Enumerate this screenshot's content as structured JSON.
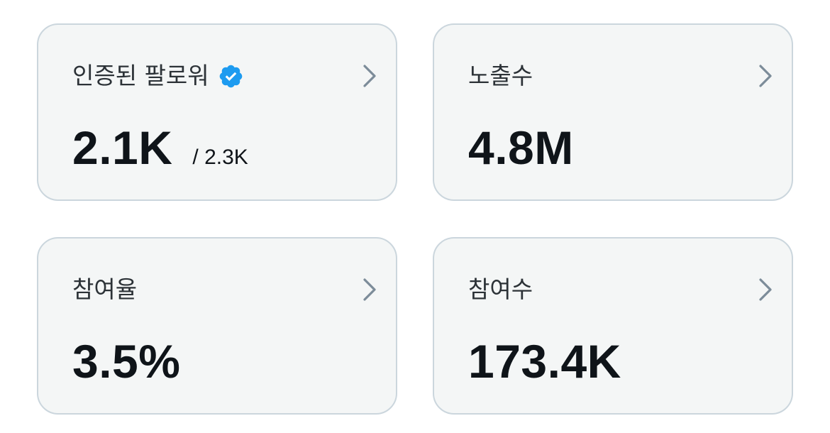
{
  "cards": [
    {
      "label": "인증된 팔로워",
      "value": "2.1K",
      "sub": "/ 2.3K",
      "badge_icon": "verified-badge-icon",
      "badge_color": "#1d9bf0",
      "chevron_icon": "chevron-right-icon"
    },
    {
      "label": "노출수",
      "value": "4.8M",
      "chevron_icon": "chevron-right-icon"
    },
    {
      "label": "참여율",
      "value": "3.5%",
      "chevron_icon": "chevron-right-icon"
    },
    {
      "label": "참여수",
      "value": "173.4K",
      "chevron_icon": "chevron-right-icon"
    }
  ],
  "colors": {
    "card_background": "#f4f6f6",
    "card_border": "#cbd6dd",
    "chevron": "#7c8c99",
    "text_primary": "#0f1419",
    "text_label": "#2c3237"
  }
}
